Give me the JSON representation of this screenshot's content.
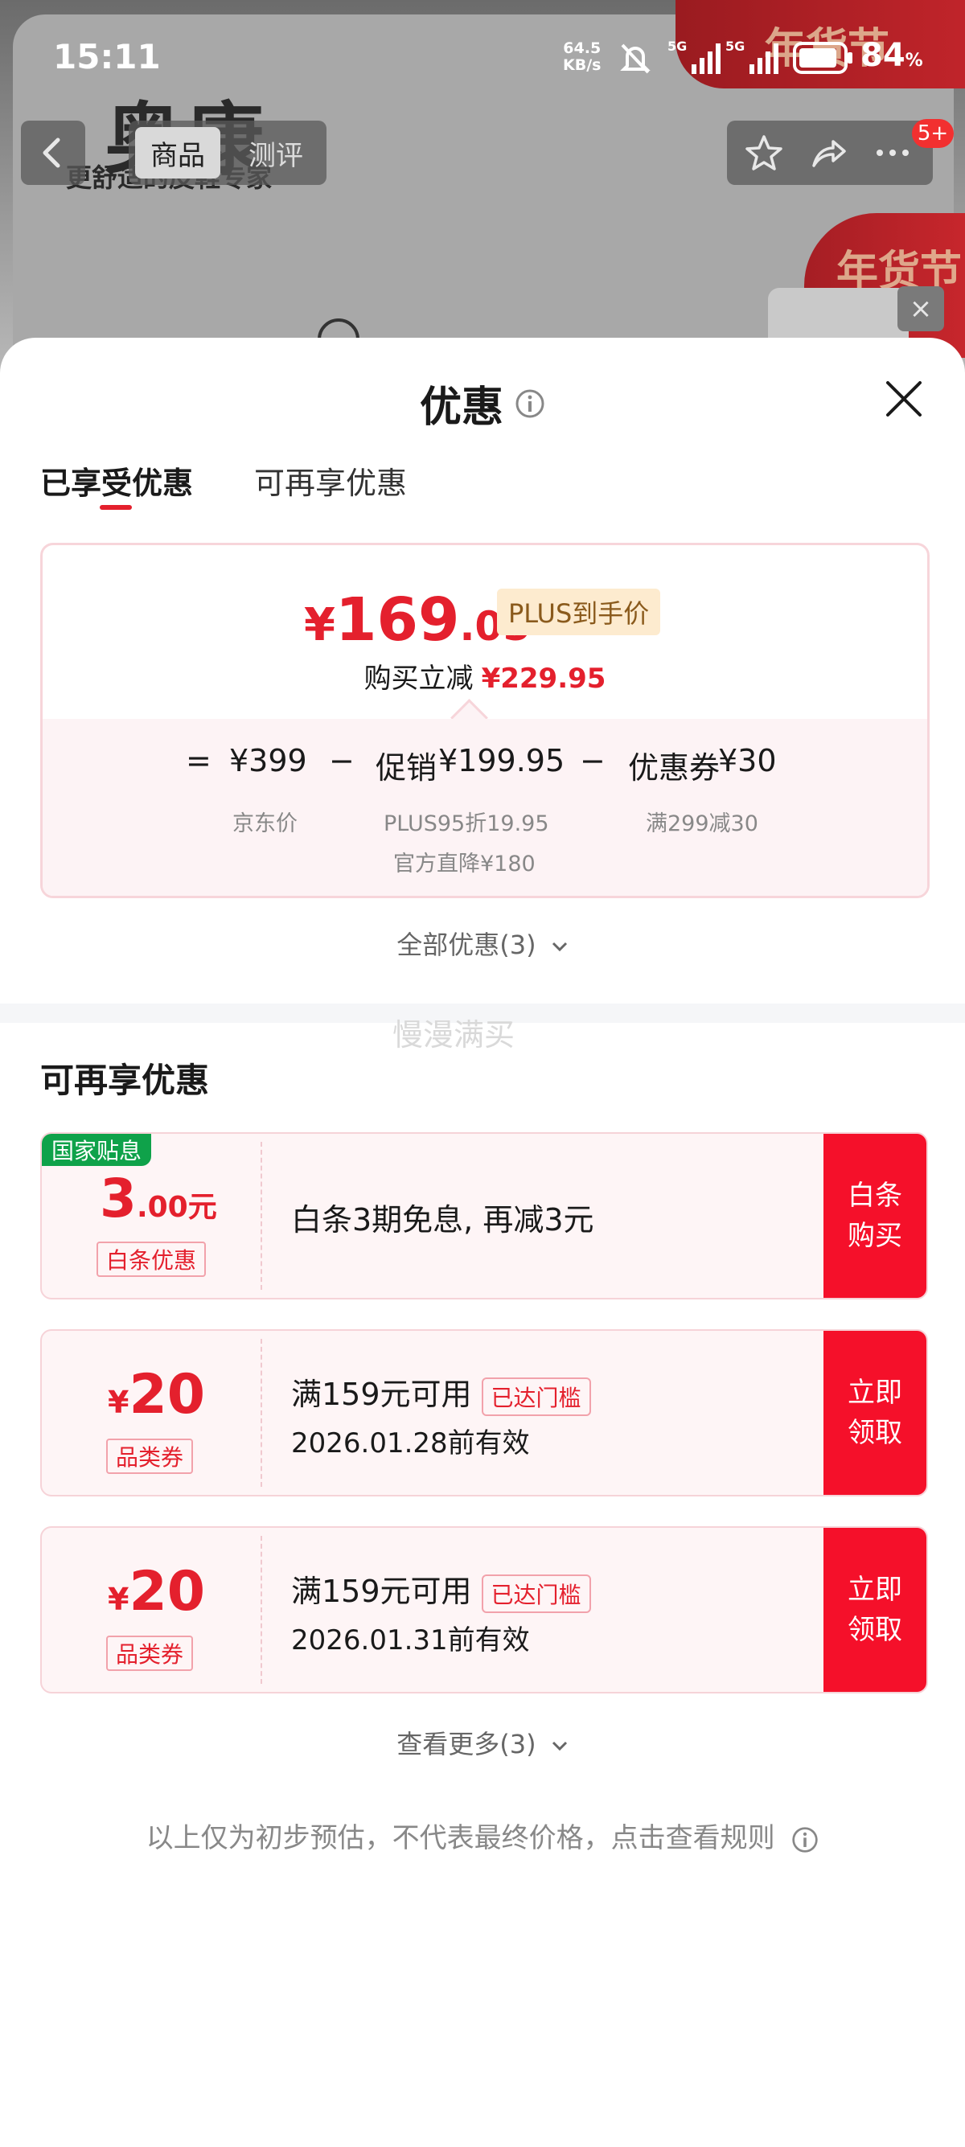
{
  "status_bar": {
    "time": "15:11",
    "net_speed_value": "64.5",
    "net_speed_unit": "KB/s",
    "network_1": "5G",
    "network_2": "5G",
    "battery_percent": "84",
    "battery_unit": "%"
  },
  "background": {
    "brand": "奥康",
    "slogan": "更舒适的皮鞋专家",
    "banner_text": "年货节"
  },
  "nav": {
    "tab_product": "商品",
    "tab_review": "测评",
    "badge": "5+"
  },
  "sheet": {
    "title": "优惠",
    "tabs": [
      "已享受优惠",
      "可再享优惠"
    ],
    "active_tab": 0,
    "price": {
      "currency": "¥",
      "integer": "169",
      "decimal": ".05",
      "plus_tag": "PLUS到手价",
      "reduce_label": "购买立减",
      "reduce_amount": "¥229.95"
    },
    "breakdown": {
      "equals": "=",
      "jd_price": "¥399",
      "jd_price_label": "京东价",
      "minus1": "−",
      "promo_label": "促销",
      "promo_amount": "¥199.95",
      "promo_sub1": "PLUS95折19.95",
      "promo_sub2": "官方直降¥180",
      "minus2": "−",
      "coupon_label": "优惠券",
      "coupon_amount": "¥30",
      "coupon_sub": "满299减30"
    },
    "all_discounts": "全部优惠(3)",
    "watermark": "慢漫满买",
    "section_title": "可再享优惠",
    "coupons": [
      {
        "tag": "国家贴息",
        "amount": "3",
        "amount_unit": ".00元",
        "type_tag": "白条优惠",
        "desc": "白条3期免息, 再减3元",
        "action": "白条\n购买"
      },
      {
        "currency": "¥",
        "amount": "20",
        "type_tag": "品类券",
        "desc": "满159元可用",
        "threshold": "已达门槛",
        "validity": "2026.01.28前有效",
        "action": "立即\n领取"
      },
      {
        "currency": "¥",
        "amount": "20",
        "type_tag": "品类券",
        "desc": "满159元可用",
        "threshold": "已达门槛",
        "validity": "2026.01.31前有效",
        "action": "立即\n领取"
      }
    ],
    "see_more": "查看更多(3)",
    "disclaimer": "以上仅为初步预估，不代表最终价格，点击查看规则"
  },
  "colors": {
    "accent_red": "#e4202d",
    "action_red": "#f5102a",
    "gov_green": "#0fa24a",
    "plus_gold": "#fdebcf"
  },
  "icons": [
    "back-icon",
    "star-icon",
    "share-icon",
    "more-icon",
    "close-icon",
    "info-icon",
    "chevron-down-icon",
    "mute-icon",
    "signal-icon",
    "battery-icon"
  ]
}
